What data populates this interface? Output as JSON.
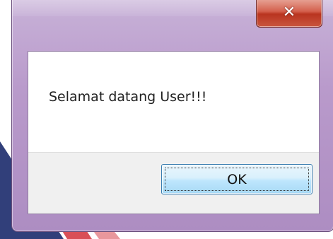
{
  "dialog": {
    "message": "Selamat datang User!!!",
    "ok_label": "OK",
    "close_icon": "close-icon",
    "colors": {
      "frame": "#b99acb",
      "close_button": "#c9563f",
      "ok_button": "#bee6fd",
      "button_bar": "#f0f0f0"
    }
  }
}
